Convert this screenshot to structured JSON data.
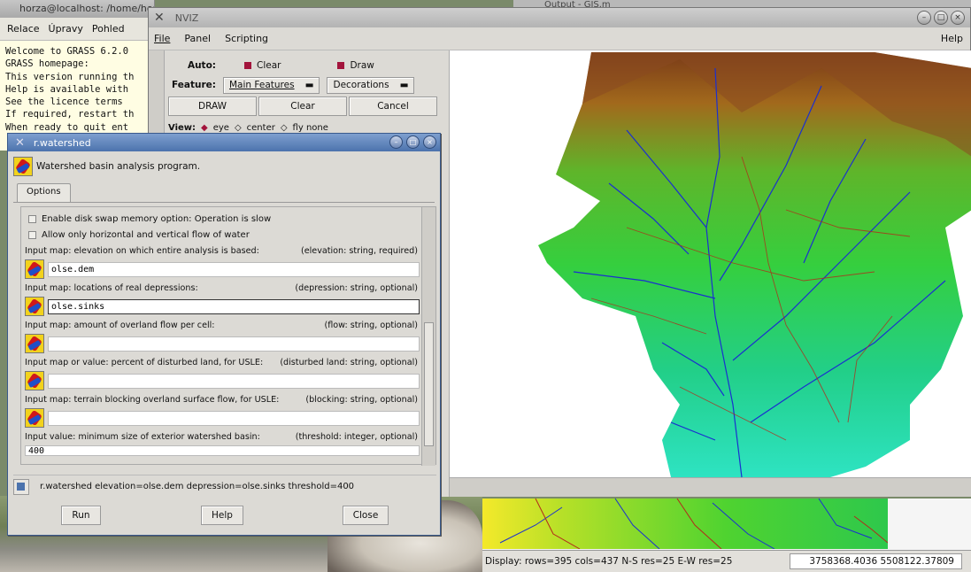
{
  "terminal": {
    "title": "horza@localhost: /home/horza - Shell - Konsole",
    "menu": [
      "Relace",
      "Úpravy",
      "Pohled"
    ],
    "lines": [
      "Welcome to GRASS 6.2.0",
      "GRASS homepage:",
      "This version running th",
      "Help is available with",
      "See the licence terms",
      "If required, restart th",
      "When ready to quit ent"
    ]
  },
  "output_title": "Output - GIS.m",
  "nviz": {
    "title": "NVIZ",
    "menu": {
      "file": "File",
      "panel": "Panel",
      "scripting": "Scripting",
      "help": "Help"
    },
    "auto_label": "Auto:",
    "clear_check": "Clear",
    "draw_check": "Draw",
    "feature_label": "Feature:",
    "feature_value": "Main Features",
    "decorations": "Decorations",
    "draw_button": "DRAW",
    "clear_button": "Clear",
    "cancel_button": "Cancel",
    "view_label": "View:",
    "view_eye": "eye",
    "view_center": "center",
    "view_fly": "fly none"
  },
  "dialog": {
    "title": "r.watershed",
    "description": "Watershed basin analysis program.",
    "tab": "Options",
    "checkboxes": [
      "Enable disk swap memory option: Operation is slow",
      "Allow only horizontal and vertical flow of water"
    ],
    "params": [
      {
        "label": "Input map: elevation on which entire analysis is based:",
        "meta": "(elevation: string, required)",
        "value": "olse.dem"
      },
      {
        "label": "Input map: locations of real depressions:",
        "meta": "(depression: string, optional)",
        "value": "olse.sinks"
      },
      {
        "label": "Input map: amount of overland flow per cell:",
        "meta": "(flow: string, optional)",
        "value": ""
      },
      {
        "label": "Input map or value: percent of disturbed land, for USLE:",
        "meta": "(disturbed land: string, optional)",
        "value": ""
      },
      {
        "label": "Input map: terrain blocking overland surface flow, for USLE:",
        "meta": "(blocking: string, optional)",
        "value": ""
      },
      {
        "label": "Input value: minimum size of exterior watershed basin:",
        "meta": "(threshold: integer, optional)",
        "value": "400"
      }
    ],
    "command": "r.watershed elevation=olse.dem depression=olse.sinks threshold=400",
    "run_button": "Run",
    "help_button": "Help",
    "close_button": "Close"
  },
  "display": {
    "status": "Display: rows=395 cols=437 N-S res=25 E-W res=25",
    "coords": "3758368.4036 5508122.37809"
  },
  "colors": {
    "dialog_title": "#4c73ad",
    "check_mark": "#a3143c",
    "stream_blue": "#1a2fd0",
    "stream_red": "#b22a1a",
    "terrain_green": "#3ed34a"
  }
}
